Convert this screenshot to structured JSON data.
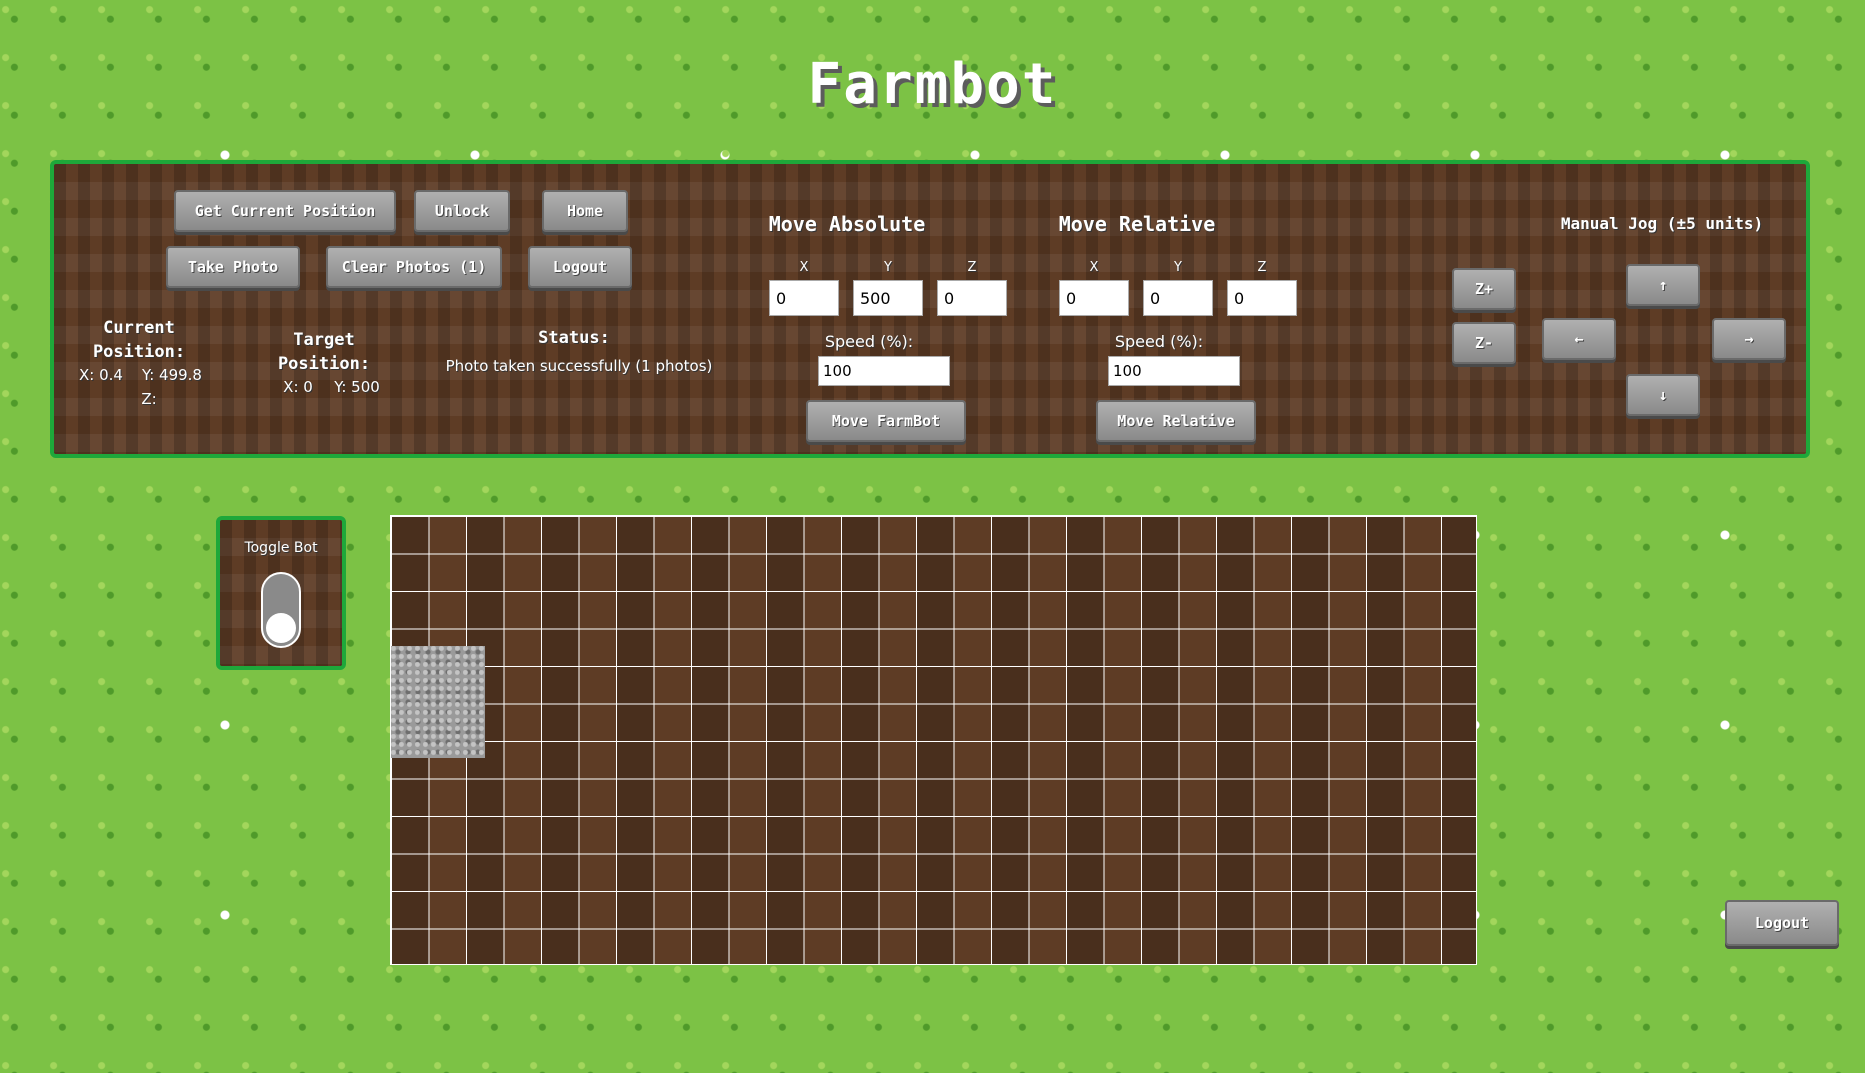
{
  "app": {
    "title": "Farmbot"
  },
  "controls": {
    "get_position": "Get Current Position",
    "unlock": "Unlock",
    "home": "Home",
    "take_photo": "Take Photo",
    "clear_photos": "Clear Photos (1)",
    "logout": "Logout"
  },
  "current": {
    "label": "Current Position:",
    "x": "X: 0.4",
    "y": "Y: 499.8",
    "z": "Z:"
  },
  "target": {
    "label": "Target Position:",
    "x": "X: 0",
    "y": "Y: 500"
  },
  "status": {
    "label": "Status:",
    "text": "Photo taken successfully (1 photos)"
  },
  "move_absolute": {
    "title": "Move Absolute",
    "x_label": "X",
    "y_label": "Y",
    "z_label": "Z",
    "x": "0",
    "y": "500",
    "z": "0",
    "speed_label": "Speed (%):",
    "speed": "100",
    "button": "Move FarmBot"
  },
  "move_relative": {
    "title": "Move Relative",
    "x_label": "X",
    "y_label": "Y",
    "z_label": "Z",
    "x": "0",
    "y": "0",
    "z": "0",
    "speed_label": "Speed (%):",
    "speed": "100",
    "button": "Move Relative"
  },
  "jog": {
    "title": "Manual Jog (±5 units)",
    "z_plus": "Z+",
    "z_minus": "Z-",
    "up": "↑",
    "down": "↓",
    "left": "←",
    "right": "→"
  },
  "toggle": {
    "label": "Toggle Bot",
    "state": "off"
  },
  "footer": {
    "logout": "Logout"
  },
  "colors": {
    "grass": "#7cc245",
    "dirt": "#5e3c25",
    "border": "#1ea83a",
    "button": "#9a9a9a"
  }
}
